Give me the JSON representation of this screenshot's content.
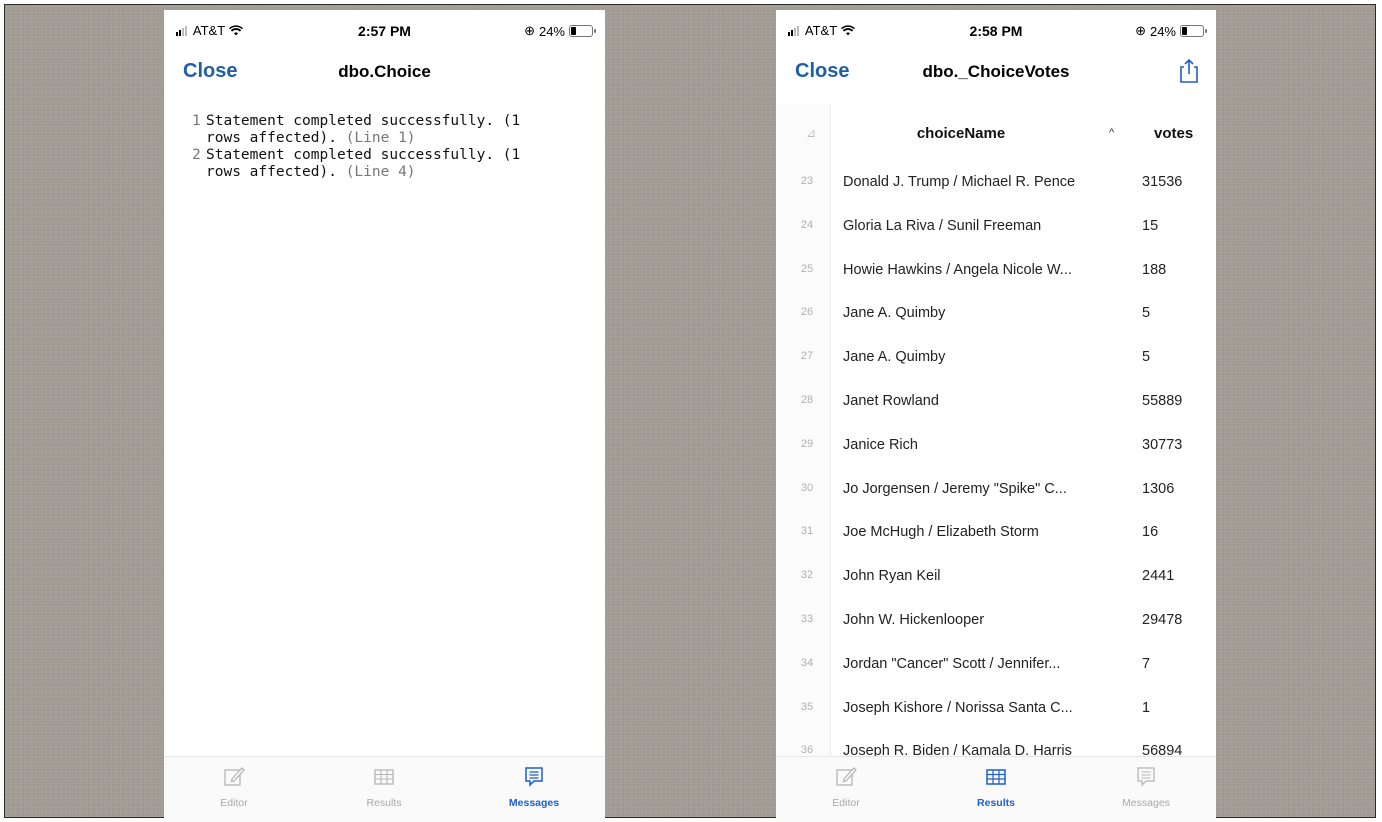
{
  "left_phone": {
    "status": {
      "carrier": "AT&T",
      "time": "2:57 PM",
      "battery": "24%",
      "battery_level": 0.24
    },
    "nav": {
      "close": "Close",
      "title": "dbo.Choice"
    },
    "messages": [
      {
        "num": "1",
        "text": "Statement completed successfully. (1\nrows affected).",
        "ref": "(Line 1)"
      },
      {
        "num": "2",
        "text": "Statement completed successfully. (1\nrows affected).",
        "ref": "(Line 4)"
      }
    ],
    "tabs": [
      {
        "label": "Editor",
        "icon": "edit-icon",
        "active": false
      },
      {
        "label": "Results",
        "icon": "table-icon",
        "active": false
      },
      {
        "label": "Messages",
        "icon": "messages-icon",
        "active": true
      }
    ]
  },
  "right_phone": {
    "status": {
      "carrier": "AT&T",
      "time": "2:58 PM",
      "battery": "24%",
      "battery_level": 0.24
    },
    "nav": {
      "close": "Close",
      "title": "dbo._ChoiceVotes",
      "share_icon": "share-icon"
    },
    "columns": {
      "corner": "⊿",
      "name": "choiceName",
      "sort": "^",
      "votes": "votes"
    },
    "rows": [
      {
        "n": "23",
        "name": "Donald J. Trump / Michael R. Pence",
        "votes": "31536"
      },
      {
        "n": "24",
        "name": "Gloria La Riva / Sunil Freeman",
        "votes": "15"
      },
      {
        "n": "25",
        "name": "Howie Hawkins / Angela Nicole W...",
        "votes": "188"
      },
      {
        "n": "26",
        "name": "Jane A. Quimby",
        "votes": "5"
      },
      {
        "n": "27",
        "name": "Jane A. Quimby",
        "votes": "5"
      },
      {
        "n": "28",
        "name": "Janet Rowland",
        "votes": "55889"
      },
      {
        "n": "29",
        "name": "Janice Rich",
        "votes": "30773"
      },
      {
        "n": "30",
        "name": "Jo Jorgensen / Jeremy \"Spike\" C...",
        "votes": "1306"
      },
      {
        "n": "31",
        "name": "Joe McHugh / Elizabeth Storm",
        "votes": "16"
      },
      {
        "n": "32",
        "name": "John Ryan Keil",
        "votes": "2441"
      },
      {
        "n": "33",
        "name": "John W. Hickenlooper",
        "votes": "29478"
      },
      {
        "n": "34",
        "name": "Jordan \"Cancer\" Scott / Jennifer...",
        "votes": "7"
      },
      {
        "n": "35",
        "name": "Joseph Kishore / Norissa Santa C...",
        "votes": "1"
      },
      {
        "n": "36",
        "name": "Joseph R. Biden / Kamala D. Harris",
        "votes": "56894"
      }
    ],
    "tabs": [
      {
        "label": "Editor",
        "icon": "edit-icon",
        "active": false
      },
      {
        "label": "Results",
        "icon": "table-icon",
        "active": true
      },
      {
        "label": "Messages",
        "icon": "messages-icon",
        "active": false
      }
    ]
  },
  "colors": {
    "accent": "#1d5fcb",
    "close_link": "#1f5fa8",
    "backdrop": "#a29b94"
  }
}
